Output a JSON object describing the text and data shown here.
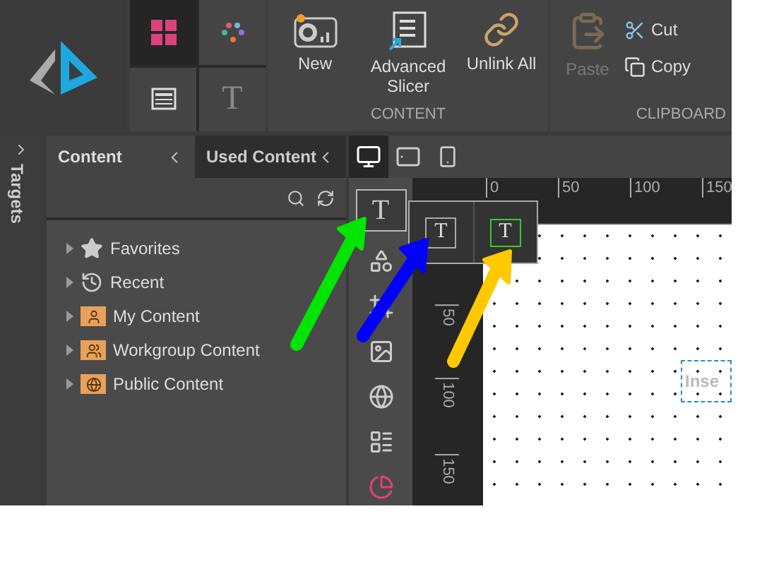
{
  "ribbon": {
    "tiles": [
      {
        "kind": "grid",
        "selected": true
      },
      {
        "kind": "dots",
        "selected": false
      },
      {
        "kind": "panel",
        "selected": false
      },
      {
        "kind": "text",
        "selected": false,
        "label": "T"
      }
    ],
    "content_group": {
      "label": "CONTENT",
      "buttons": [
        {
          "kind": "new",
          "label": "New"
        },
        {
          "kind": "slicer",
          "label": "Advanced Slicer"
        },
        {
          "kind": "unlink",
          "label": "Unlink All"
        }
      ]
    },
    "clipboard_group": {
      "label": "CLIPBOARD",
      "paste": {
        "label": "Paste",
        "disabled": true
      },
      "buttons": [
        {
          "kind": "cut",
          "label": "Cut",
          "disabled": false
        },
        {
          "kind": "copy",
          "label": "Copy",
          "disabled": false
        }
      ]
    }
  },
  "targets": {
    "label": "Targets"
  },
  "panel": {
    "tabs": [
      {
        "label": "Content",
        "selected": true
      },
      {
        "label": "Used Content",
        "selected": false
      }
    ],
    "tree": [
      {
        "kind": "star",
        "label": "Favorites"
      },
      {
        "kind": "history",
        "label": "Recent"
      },
      {
        "kind": "user",
        "label": "My Content"
      },
      {
        "kind": "group",
        "label": "Workgroup Content"
      },
      {
        "kind": "globe",
        "label": "Public Content"
      }
    ]
  },
  "view_modes": [
    {
      "kind": "desktop",
      "selected": true
    },
    {
      "kind": "tablet",
      "selected": false
    },
    {
      "kind": "phone",
      "selected": false
    }
  ],
  "tools": [
    {
      "kind": "text",
      "label": "T"
    },
    {
      "kind": "shape"
    },
    {
      "kind": "frame"
    },
    {
      "kind": "image"
    },
    {
      "kind": "globe"
    },
    {
      "kind": "list"
    },
    {
      "kind": "chart"
    }
  ],
  "flyout": [
    {
      "kind": "boxed",
      "label": "T"
    },
    {
      "kind": "handles",
      "label": "T"
    }
  ],
  "ruler": {
    "x_labels": [
      "0",
      "50",
      "100",
      "150"
    ],
    "y_labels": [
      "50",
      "100",
      "150"
    ]
  },
  "canvas": {
    "text_box": "Inse"
  },
  "annotations": [
    {
      "color": "#00e600"
    },
    {
      "color": "#0000ff"
    },
    {
      "color": "#ffc800"
    }
  ]
}
